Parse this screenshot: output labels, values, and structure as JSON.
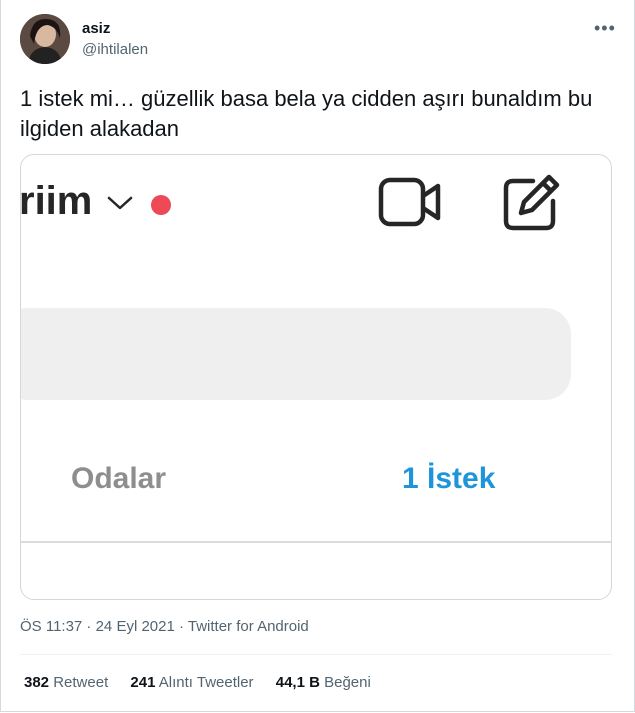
{
  "author": {
    "name": "asiz",
    "handle": "@ihtilalen"
  },
  "tweet": {
    "text": "1 istek mi… güzellik basa bela ya cidden aşırı bunaldım bu ilgiden alakadan"
  },
  "screenshot": {
    "title_fragment": "riim",
    "tabs": [
      "Odalar",
      "1 İstek"
    ],
    "dot_color": "#ed4956",
    "active_tab_color": "#1e94da"
  },
  "meta": {
    "text": "ÖS 11:37 · 24 Eyl 2021 · Twitter for Android"
  },
  "stats": [
    {
      "count": "382",
      "label": "Retweet"
    },
    {
      "count": "241",
      "label": "Alıntı Tweetler"
    },
    {
      "count": "44,1 B",
      "label": "Beğeni"
    }
  ],
  "icons": [
    "more-icon",
    "chevron-down-icon",
    "video-call-icon",
    "edit-icon"
  ]
}
